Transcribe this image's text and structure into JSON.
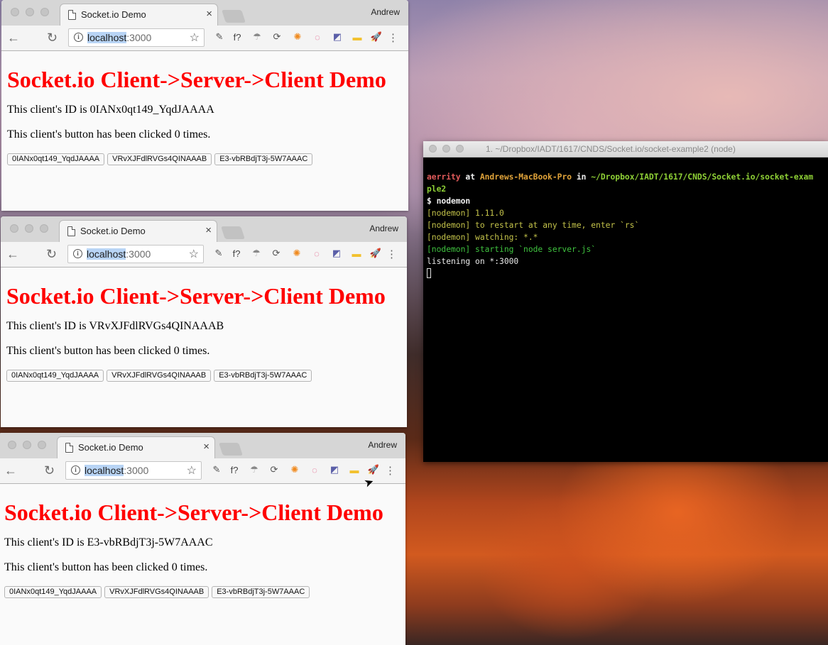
{
  "browser": {
    "tab_title": "Socket.io Demo",
    "tab_close": "×",
    "profile_name": "Andrew",
    "url_host": "localhost",
    "url_port": ":3000",
    "back_glyph": "←",
    "reload_glyph": "↻",
    "star_glyph": "☆",
    "menu_glyph": "⋮",
    "extensions": [
      {
        "name": "eyedropper-icon",
        "glyph": "✎",
        "color": "#555"
      },
      {
        "name": "function-icon",
        "glyph": "f?",
        "color": "#444"
      },
      {
        "name": "reeder-icon",
        "glyph": "☂",
        "color": "#888"
      },
      {
        "name": "sync-icon",
        "glyph": "⟳",
        "color": "#555"
      },
      {
        "name": "orange-circle-icon",
        "glyph": "✺",
        "color": "#f08a1e"
      },
      {
        "name": "color-wheel-icon",
        "glyph": "◌",
        "color": "#e0507d"
      },
      {
        "name": "diagonal-icon",
        "glyph": "◩",
        "color": "#5b5fa8"
      },
      {
        "name": "yellow-box-icon",
        "glyph": "▬",
        "color": "#f2c12e"
      },
      {
        "name": "rocket-icon",
        "glyph": "🚀",
        "color": "#666"
      }
    ]
  },
  "page": {
    "heading": "Socket.io Client->Server->Client Demo",
    "id_label": "This client's ID is ",
    "click_text": "This client's button has been clicked 0 times.",
    "client_buttons": [
      "0IANx0qt149_YqdJAAAA",
      "VRvXJFdlRVGs4QINAAAB",
      "E3-vbRBdjT3j-5W7AAAC"
    ]
  },
  "windows": [
    {
      "client_id": "0IANx0qt149_YqdJAAAA"
    },
    {
      "client_id": "VRvXJFdlRVGs4QINAAAB"
    },
    {
      "client_id": "E3-vbRBdjT3j-5W7AAAC"
    }
  ],
  "terminal": {
    "title": "1. ~/Dropbox/IADT/1617/CNDS/Socket.io/socket-example2 (node)",
    "prompt_user": "aerrity",
    "prompt_at": " at ",
    "prompt_host": "Andrews-MacBook-Pro",
    "prompt_in": " in ",
    "prompt_path": "~/Dropbox/IADT/1617/CNDS/Socket.io/socket-exam",
    "prompt_path_wrap": "ple2",
    "command": "$ nodemon",
    "line_version": "[nodemon] 1.11.0",
    "line_restart": "[nodemon] to restart at any time, enter `rs`",
    "line_watching": "[nodemon] watching: *.*",
    "line_starting": "[nodemon] starting `node server.js`",
    "line_listening": "listening on *:3000"
  }
}
